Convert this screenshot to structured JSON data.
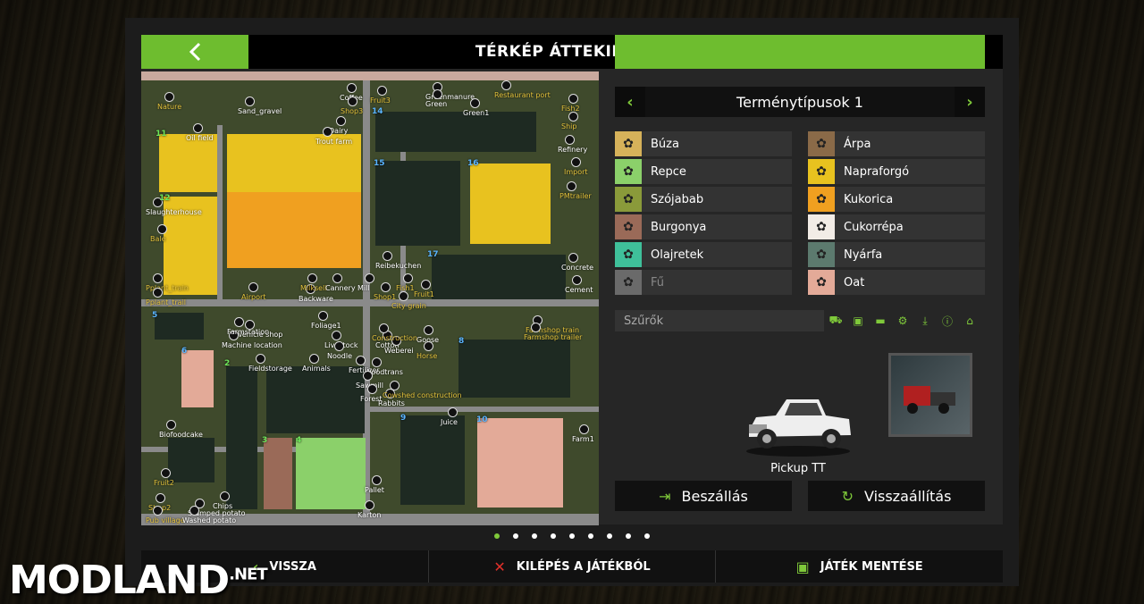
{
  "header": {
    "title": "TÉRKÉP ÁTTEKINTÉSE"
  },
  "fruit_panel": {
    "title": "Terménytípusok 1"
  },
  "legend": [
    {
      "name": "Búza",
      "color": "#d6b25a",
      "icon": "wheat-icon",
      "dim": false
    },
    {
      "name": "Árpa",
      "color": "#8a6a48",
      "icon": "barley-icon",
      "dim": false
    },
    {
      "name": "Repce",
      "color": "#8bd06a",
      "icon": "canola-icon",
      "dim": false
    },
    {
      "name": "Napraforgó",
      "color": "#e8c21f",
      "icon": "sunflower-icon",
      "dim": false
    },
    {
      "name": "Szójabab",
      "color": "#8a9a3a",
      "icon": "soybean-icon",
      "dim": false
    },
    {
      "name": "Kukorica",
      "color": "#f0a020",
      "icon": "corn-icon",
      "dim": false
    },
    {
      "name": "Burgonya",
      "color": "#9a6a58",
      "icon": "potato-icon",
      "dim": false
    },
    {
      "name": "Cukorrépa",
      "color": "#f2ece6",
      "icon": "sugarbeet-icon",
      "dim": false
    },
    {
      "name": "Olajretek",
      "color": "#3fc09a",
      "icon": "oilradish-icon",
      "dim": false
    },
    {
      "name": "Nyárfa",
      "color": "#5c7a6e",
      "icon": "poplar-icon",
      "dim": false
    },
    {
      "name": "Fű",
      "color": "#6a6a6a",
      "icon": "grass-icon",
      "dim": true
    },
    {
      "name": "Oat",
      "color": "#e3aa98",
      "icon": "oat-icon",
      "dim": false
    }
  ],
  "filters": {
    "label": "Szűrők",
    "icons": [
      "tractor-icon",
      "harvester-icon",
      "trailer-icon",
      "tool-icon",
      "sell-point-icon",
      "warning-icon",
      "home-icon"
    ]
  },
  "vehicle": {
    "name": "Pickup TT"
  },
  "actions": {
    "enter": "Beszállás",
    "reset": "Visszaállítás"
  },
  "pagination": {
    "count": 9,
    "active": 0
  },
  "footer": {
    "back": "VISSZA",
    "quit": "KILÉPÉS A JÁTÉKBÓL",
    "save": "JÁTÉK MENTÉSE"
  },
  "map_labels": [
    "Nature",
    "Sand_gravel",
    "Coffee",
    "Fruit3",
    "Greenmanure",
    "Green",
    "Restaurant port",
    "Fish2",
    "Shop3",
    "Dairy",
    "Trout farm",
    "Green1",
    "Ship",
    "Oil field",
    "Refinery",
    "Import",
    "PMtrailer",
    "Slaughterhouse",
    "Bale",
    "Reibekuchen",
    "Concrete",
    "Cement",
    "Pplant_train",
    "Pplant_trail",
    "Airport",
    "Backware",
    "Milksell",
    "Cannery",
    "Mill",
    "Shop1",
    "Fish1",
    "Fruit1",
    "City grain",
    "Farmshop train",
    "Farmshop trailer",
    "Vehicle shop",
    "Machine location",
    "Livestock",
    "Cotton",
    "Goose",
    "Weberei",
    "Horse",
    "Noodle",
    "Fertilizer",
    "Animals",
    "Woodtrans",
    "Sawmill",
    "Forest",
    "Rabbits",
    "Cowshed construction",
    "Juice",
    "Farm1",
    "Biofoodcake",
    "Fruit2",
    "Shop2",
    "Pub village",
    "Chips",
    "Stamped potato",
    "Washed potato",
    "Pallet",
    "Karton",
    "Construction",
    "Fieldstorage",
    "Foliage1",
    "Farmstation",
    "11",
    "12",
    "14",
    "15",
    "16",
    "17",
    "2",
    "3",
    "4",
    "5",
    "6",
    "8",
    "9",
    "10"
  ],
  "watermark": {
    "brand": "MODLAND",
    "suffix": ".NET"
  }
}
